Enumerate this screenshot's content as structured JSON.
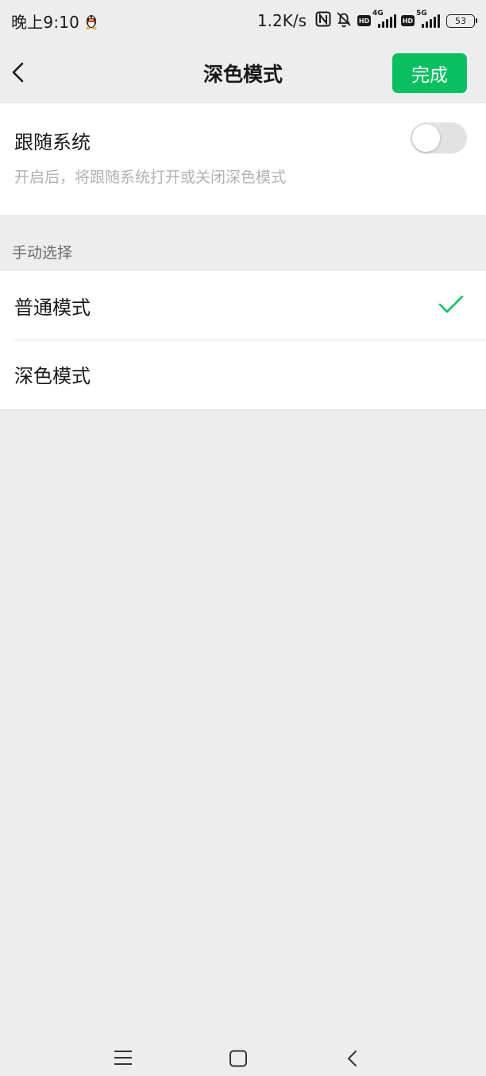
{
  "status_bar": {
    "time": "晚上9:10",
    "speed": "1.2K/s",
    "hd_label": "HD",
    "network_1": "4G",
    "network_2": "5G",
    "battery": "53"
  },
  "nav": {
    "title": "深色模式",
    "done_label": "完成"
  },
  "follow_system": {
    "title": "跟随系统",
    "description": "开启后，将跟随系统打开或关闭深色模式",
    "enabled": false
  },
  "manual": {
    "header": "手动选择",
    "options": [
      {
        "label": "普通模式",
        "selected": true
      },
      {
        "label": "深色模式",
        "selected": false
      }
    ]
  },
  "colors": {
    "accent": "#07c160",
    "background": "#ededed",
    "toggle_off": "#e2e2e2"
  }
}
